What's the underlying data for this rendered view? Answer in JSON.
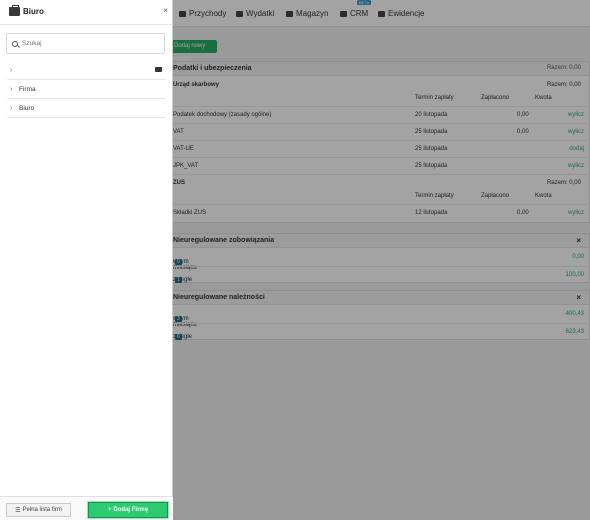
{
  "nav": {
    "items": [
      {
        "label": "Przychody",
        "icon": "income-icon"
      },
      {
        "label": "Wydatki",
        "icon": "expense-icon"
      },
      {
        "label": "Magazyn",
        "icon": "warehouse-icon"
      },
      {
        "label": "CRM",
        "icon": "crm-icon",
        "badge": "BETA"
      },
      {
        "label": "Ewidencje",
        "icon": "folder-icon"
      }
    ]
  },
  "main": {
    "add_module": "Dodaj nowy moduł",
    "panel1": {
      "title": "Podatki i ubezpieczenia",
      "total": "Razem: 0,00",
      "sub1_title": "Urząd skarbowy",
      "sub1_total": "Razem: 0,00",
      "columns": {
        "date": "Termin zapłaty",
        "paid": "Zapłacono",
        "amount": "Kwota"
      },
      "rows1": [
        {
          "name": "Podatek dochodowy (zasady ogólne)",
          "date": "20 listopada",
          "paid": "0,00",
          "action": "wylicz"
        },
        {
          "name": "VAT",
          "date": "25 listopada",
          "paid": "0,00",
          "action": "wylicz"
        },
        {
          "name": "VAT-UE",
          "date": "25 listopada",
          "paid": "",
          "action": "dodaj"
        },
        {
          "name": "JPK_VAT",
          "date": "25 listopada",
          "paid": "",
          "action": "wylicz"
        }
      ],
      "sub2_title": "ZUS",
      "sub2_total": "Razem: 0,00",
      "rows2": [
        {
          "name": "Składki ZUS",
          "date": "12 listopada",
          "paid": "0,00",
          "action": "wylicz"
        }
      ]
    },
    "panel2": {
      "title": "Nieuregulowane zobowiązania",
      "rows": [
        {
          "label": "w tym miesiącu",
          "badge": "0",
          "value": "0,00"
        },
        {
          "label": "zaległe",
          "badge": "1",
          "value": "100,00"
        }
      ]
    },
    "panel3": {
      "title": "Nieuregulowane należności",
      "rows": [
        {
          "label": "w tym miesiącu",
          "badge": "3",
          "value": "400,43"
        },
        {
          "label": "zaległe",
          "badge": "6",
          "value": "623,43"
        }
      ]
    }
  },
  "drawer": {
    "title": "Biuro",
    "search_placeholder": "Szukaj",
    "items": [
      {
        "label": ""
      },
      {
        "label": "Firma"
      },
      {
        "label": "Biuro"
      }
    ],
    "footer": {
      "list_button": "Pełna lista firm",
      "add_button": "Dodaj Firmę"
    }
  },
  "colors": {
    "accent": "#2ecc71",
    "badge": "#1e6f8e",
    "beta": "#3aa0d6"
  }
}
